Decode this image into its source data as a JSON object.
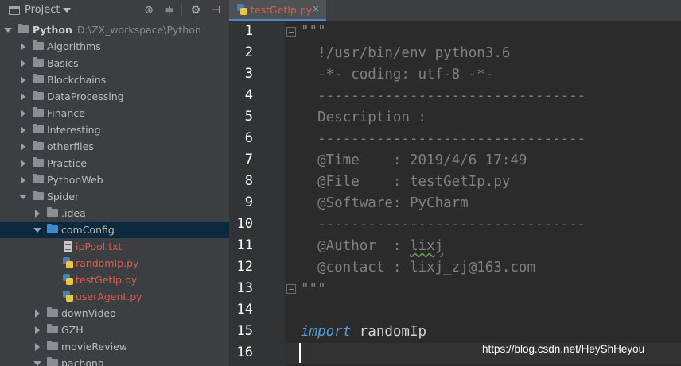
{
  "project_panel": {
    "title": "Project",
    "toolbar_icons": [
      "target-icon",
      "collapse-icon",
      "gear-icon",
      "hide-icon"
    ],
    "tree": [
      {
        "label": "Python",
        "path": "D:\\ZX_workspace\\Python",
        "type": "folder",
        "state": "expanded",
        "level": 0,
        "bold": true
      },
      {
        "label": "Algorithms",
        "type": "folder",
        "state": "collapsed",
        "level": 1
      },
      {
        "label": "Basics",
        "type": "folder",
        "state": "collapsed",
        "level": 1
      },
      {
        "label": "Blockchains",
        "type": "folder",
        "state": "collapsed",
        "level": 1
      },
      {
        "label": "DataProcessing",
        "type": "folder",
        "state": "collapsed",
        "level": 1
      },
      {
        "label": "Finance",
        "type": "folder",
        "state": "collapsed",
        "level": 1
      },
      {
        "label": "Interesting",
        "type": "folder",
        "state": "collapsed",
        "level": 1
      },
      {
        "label": "otherfiles",
        "type": "folder",
        "state": "collapsed",
        "level": 1
      },
      {
        "label": "Practice",
        "type": "folder",
        "state": "collapsed",
        "level": 1
      },
      {
        "label": "PythonWeb",
        "type": "folder",
        "state": "collapsed",
        "level": 1
      },
      {
        "label": "Spider",
        "type": "folder",
        "state": "expanded",
        "level": 1
      },
      {
        "label": ".idea",
        "type": "folder",
        "state": "collapsed",
        "level": 2
      },
      {
        "label": "comConfig",
        "type": "folder-blue",
        "state": "expanded",
        "level": 2,
        "selected": true
      },
      {
        "label": "ipPool.txt",
        "type": "txt",
        "level": 3,
        "error": true
      },
      {
        "label": "randomIp.py",
        "type": "py",
        "level": 3,
        "error": true
      },
      {
        "label": "testGetIp.py",
        "type": "py",
        "level": 3,
        "error": true
      },
      {
        "label": "userAgent.py",
        "type": "py",
        "level": 3,
        "error": true
      },
      {
        "label": "downVideo",
        "type": "folder",
        "state": "collapsed",
        "level": 2
      },
      {
        "label": "GZH",
        "type": "folder",
        "state": "collapsed",
        "level": 2
      },
      {
        "label": "movieReview",
        "type": "folder",
        "state": "collapsed",
        "level": 2
      },
      {
        "label": "pachong",
        "type": "folder",
        "state": "expanded",
        "level": 2
      }
    ]
  },
  "editor": {
    "tab": {
      "label": "testGetIp.py",
      "close": "×"
    },
    "lines": [
      {
        "n": "1",
        "text": "\"\"\"",
        "kind": "doc",
        "fold": true
      },
      {
        "n": "2",
        "text": "  !/usr/bin/env python3.6",
        "kind": "doc"
      },
      {
        "n": "3",
        "text": "  -*- coding: utf-8 -*-",
        "kind": "doc"
      },
      {
        "n": "4",
        "text": "  --------------------------------",
        "kind": "doc"
      },
      {
        "n": "5",
        "text": "  Description :",
        "kind": "doc"
      },
      {
        "n": "6",
        "text": "  --------------------------------",
        "kind": "doc"
      },
      {
        "n": "7",
        "text": "  @Time    : 2019/4/6 17:49",
        "kind": "doc"
      },
      {
        "n": "8",
        "text": "  @File    : testGetIp.py",
        "kind": "doc"
      },
      {
        "n": "9",
        "text": "  @Software: PyCharm",
        "kind": "doc"
      },
      {
        "n": "10",
        "text": "  --------------------------------",
        "kind": "doc"
      },
      {
        "n": "11",
        "text": "  @Author  : lixj",
        "kind": "doc"
      },
      {
        "n": "12",
        "text": "  @contact : lixj_zj@163.com",
        "kind": "doc"
      },
      {
        "n": "13",
        "text": "\"\"\"",
        "kind": "doc",
        "fold": true
      },
      {
        "n": "14",
        "text": "",
        "kind": "blank"
      },
      {
        "n": "15",
        "keyword": "import",
        "rest": " randomIp",
        "kind": "import"
      },
      {
        "n": "16",
        "text": "",
        "kind": "current"
      }
    ]
  },
  "watermark": "https://blog.csdn.net/HeyShHeyou",
  "colors": {
    "panel_bg": "#3c3f41",
    "editor_bg": "#2b2b2b",
    "selection": "#0d293e",
    "error_file": "#e0584f",
    "docstring": "#629755",
    "keyword": "#569cd6"
  }
}
